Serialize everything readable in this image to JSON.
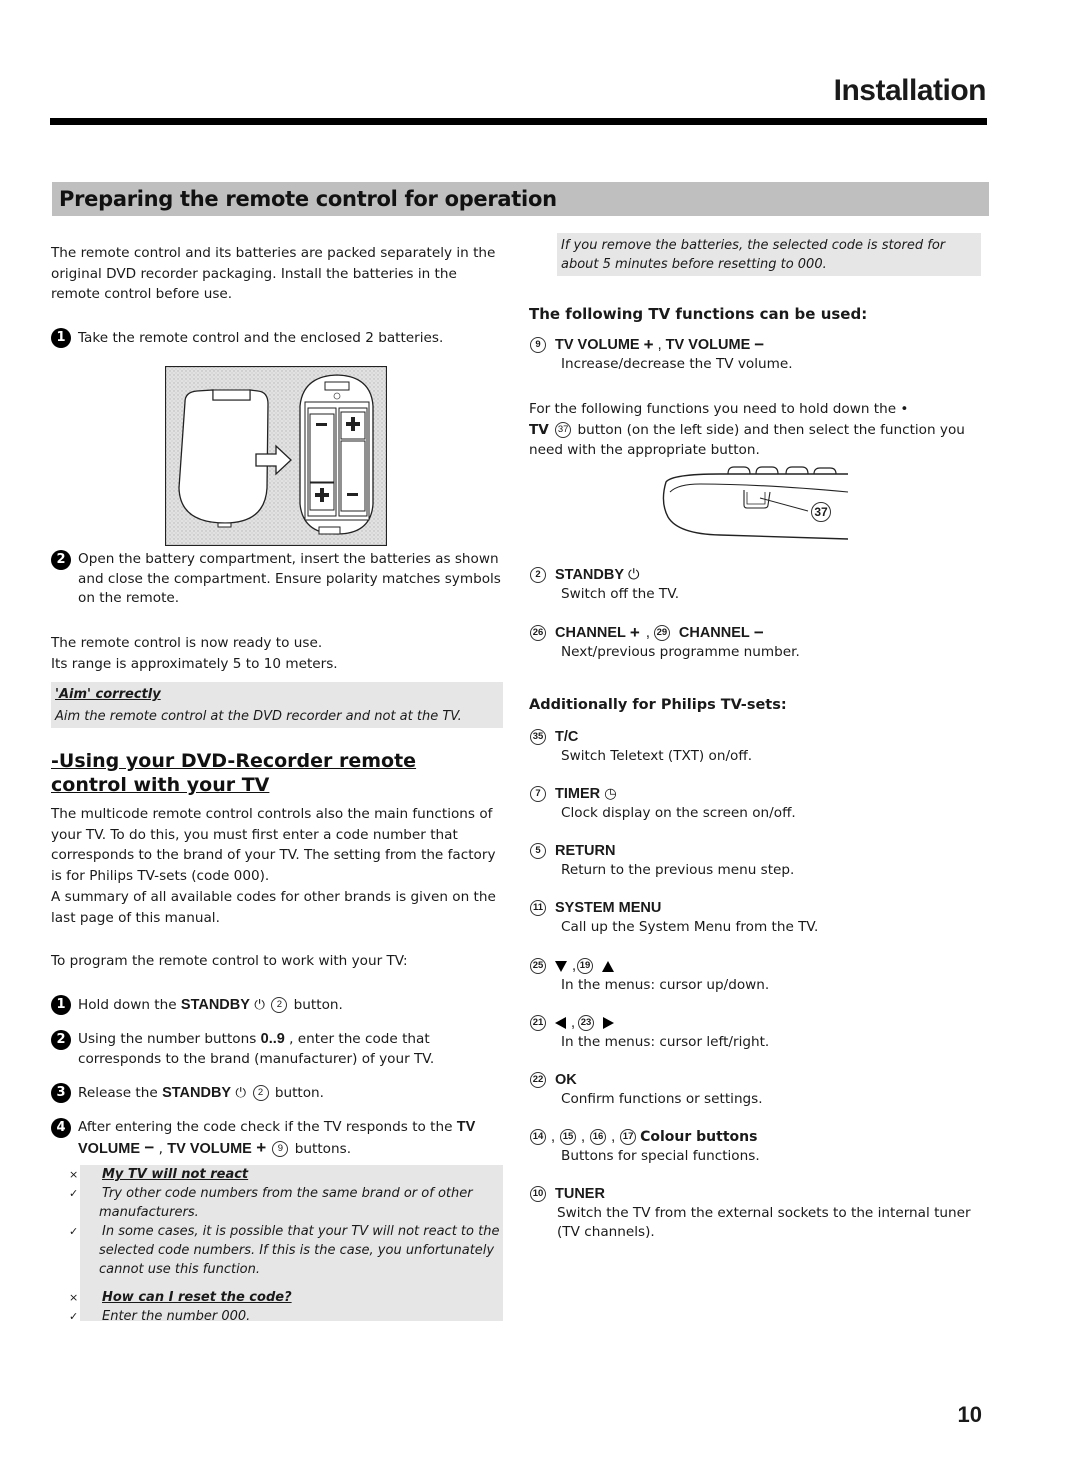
{
  "header": {
    "title": "Installation"
  },
  "section": {
    "title": "Preparing the remote control for operation"
  },
  "left": {
    "intro": "The remote control and its batteries are packed separately in the original DVD recorder packaging. Install the batteries in the remote control before use.",
    "battery_steps": [
      {
        "num": "1",
        "text": "Take the remote control and the enclosed 2 batteries."
      },
      {
        "num": "2",
        "text": "Open the battery compartment, insert the batteries as shown and close the compartment. Ensure polarity matches symbols on the remote."
      }
    ],
    "ready_line1": "The remote control is now ready to use.",
    "ready_line2": "Its range is approximately 5 to 10 meters.",
    "aim_note": {
      "title": "'Aim' correctly",
      "text": "Aim the remote control at the DVD recorder and not at the TV."
    },
    "subheading": "-Using your DVD-Recorder remote control with your TV",
    "multicode_para": "The multicode remote control controls also the main functions of your TV. To do this, you must first enter a code number that corresponds to the brand of your TV. The setting from the factory is for Philips TV-sets (code 000).",
    "summary_para": "A summary of all available codes for other brands is given on the last page of this manual.",
    "program_intro": "To program the remote control to work with your TV:",
    "program_steps": [
      {
        "num": "1",
        "pre": "Hold down the ",
        "key": "STANDBY",
        "icon": "⏻",
        "circle": "2",
        "post": " button."
      },
      {
        "num": "2",
        "pre": "Using the number buttons ",
        "key": "0..9",
        "post": " , enter the code that corresponds to the brand (manufacturer) of your TV."
      },
      {
        "num": "3",
        "pre": "Release the ",
        "key": "STANDBY",
        "icon": "⏻",
        "circle": "2",
        "post": " button."
      },
      {
        "num": "4",
        "pre": "After entering the code check if the TV responds to the ",
        "key1": "TV VOLUME",
        "sym1": "−",
        "sep": " , ",
        "key2": "TV VOLUME",
        "sym2": "+",
        "circle": "9",
        "post": " buttons."
      }
    ],
    "faq": [
      {
        "mark": "×",
        "title": "My TV will not react",
        "answers": [
          "Try other code numbers from the same brand or of other manufacturers.",
          "In some cases, it is possible that your TV will not react to the selected code numbers. If this is the case, you unfortunately cannot use this function."
        ]
      },
      {
        "mark": "×",
        "title": "How can I reset the code?",
        "answers": [
          "Enter the number 000."
        ]
      }
    ],
    "check_mark": "✓"
  },
  "right": {
    "battery_note": "If you remove the batteries, the selected code is stored for about 5 minutes before resetting to 000.",
    "functions_heading": "The following TV functions can be used:",
    "volume_fn": {
      "circle": "9",
      "label1": "TV VOLUME",
      "sym1": "+",
      "sep": " , ",
      "label2": "TV VOLUME",
      "sym2": "−",
      "desc": "Increase/decrease the TV volume."
    },
    "hold_para_line1": "For the following functions you need to hold down the •",
    "hold_tv": "TV",
    "hold_circle": "37",
    "hold_para_rest": " button (on the left side) and then select the function you need with the appropriate button.",
    "remote_callout": "37",
    "standby_fn": {
      "circle": "2",
      "label": "STANDBY",
      "icon": "⏻",
      "desc": "Switch off the TV."
    },
    "channel_fn": {
      "circle1": "26",
      "label1": "CHANNEL",
      "sym1": "+",
      "circle2": "29",
      "label2": "CHANNEL",
      "sym2": "−",
      "desc": "Next/previous programme number."
    },
    "philips_heading": "Additionally for Philips TV-sets:",
    "philips_functions": [
      {
        "circle": "35",
        "label": "T/C",
        "desc": "Switch Teletext (TXT) on/off."
      },
      {
        "circle": "7",
        "label": "TIMER",
        "icon": "◷",
        "desc": "Clock display on the screen on/off."
      },
      {
        "circle": "5",
        "label": "RETURN",
        "desc": "Return to the previous menu step."
      },
      {
        "circle": "11",
        "label": "SYSTEM MENU",
        "desc": "Call up the System Menu from the TV."
      }
    ],
    "updown_fn": {
      "circle1": "25",
      "circle2": "19",
      "desc": "In the menus: cursor up/down."
    },
    "leftright_fn": {
      "circle1": "21",
      "circle2": "23",
      "desc": "In the menus: cursor left/right."
    },
    "ok_fn": {
      "circle": "22",
      "label": "OK",
      "desc": "Confirm functions or settings."
    },
    "colour_fn": {
      "circles": [
        "14",
        "15",
        "16",
        "17"
      ],
      "label": "Colour buttons",
      "desc": "Buttons for special functions."
    },
    "tuner_fn": {
      "circle": "10",
      "label": "TUNER",
      "desc": "Switch the TV from the external sockets to the internal tuner (TV channels)."
    }
  },
  "page_number": "10"
}
